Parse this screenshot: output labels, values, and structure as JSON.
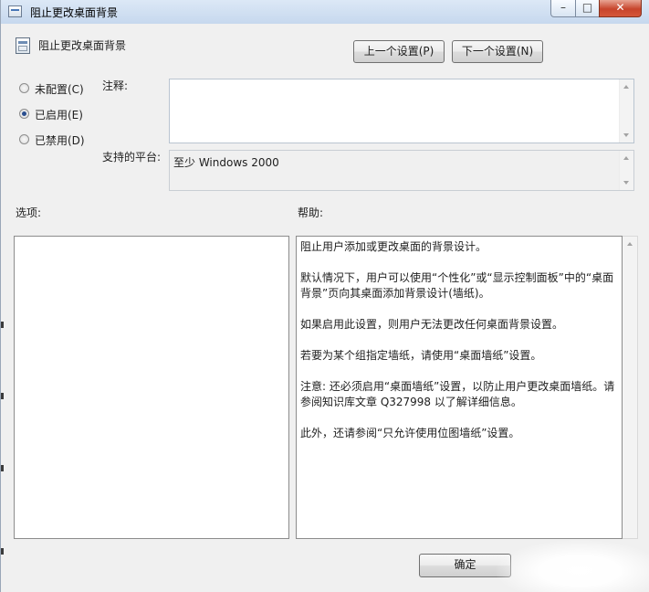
{
  "window": {
    "title": "阻止更改桌面背景",
    "controls": {
      "minimize": "–",
      "maximize": "□",
      "close": "✕"
    }
  },
  "header": {
    "setting_title": "阻止更改桌面背景",
    "prev_button": "上一个设置(P)",
    "next_button": "下一个设置(N)"
  },
  "state": {
    "options": [
      {
        "label": "未配置(C)",
        "checked": false
      },
      {
        "label": "已启用(E)",
        "checked": true
      },
      {
        "label": "已禁用(D)",
        "checked": false
      }
    ]
  },
  "comment": {
    "label": "注释:",
    "value": ""
  },
  "platform": {
    "label": "支持的平台:",
    "value": "至少 Windows 2000"
  },
  "sections": {
    "options_label": "选项:",
    "help_label": "帮助:"
  },
  "help": {
    "paragraphs": [
      "阻止用户添加或更改桌面的背景设计。",
      "默认情况下，用户可以使用“个性化”或“显示控制面板”中的“桌面背景”页向其桌面添加背景设计(墙纸)。",
      "如果启用此设置，则用户无法更改任何桌面背景设置。",
      "若要为某个组指定墙纸，请使用“桌面墙纸”设置。",
      "注意: 还必须启用“桌面墙纸”设置，以防止用户更改桌面墙纸。请参阅知识库文章 Q327998 以了解详细信息。",
      "此外，还请参阅“只允许使用位图墙纸”设置。"
    ]
  },
  "footer": {
    "ok_button": "确定"
  },
  "icons": {
    "title_icon": "policy-window-icon",
    "setting_icon": "policy-setting-icon",
    "scroll_up": "arrow-up-icon",
    "scroll_down": "arrow-down-icon"
  }
}
